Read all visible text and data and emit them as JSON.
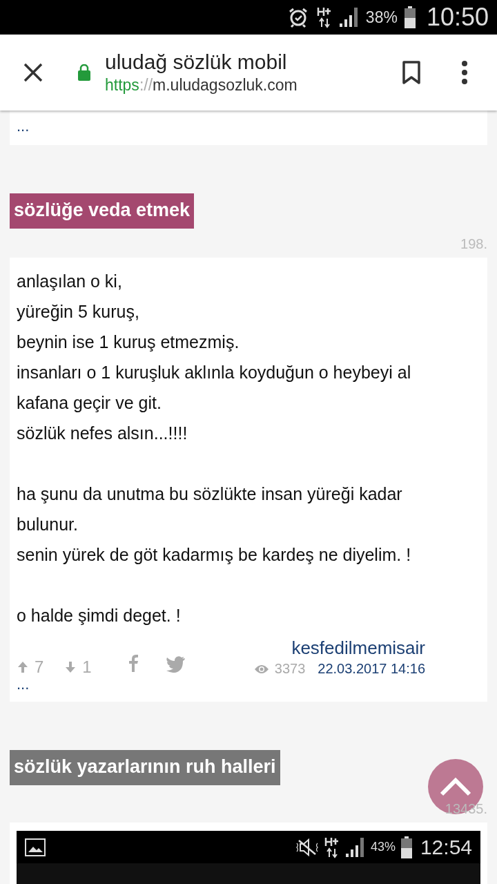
{
  "status_bar": {
    "battery": "38%",
    "time": "10:50"
  },
  "browser_bar": {
    "title": "uludağ sözlük mobil",
    "url_scheme": "https",
    "url_separator": "://",
    "url_host": "m.uludagsozluk.com"
  },
  "previous_entry": {
    "more": "..."
  },
  "topics": [
    {
      "title": "sözlüğe veda etmek",
      "color": "#a4486f",
      "entry_number": "198.",
      "entry": {
        "paragraphs": [
          [
            "anlaşılan o ki,",
            "yüreğin 5 kuruş,",
            "beynin ise 1 kuruş etmezmiş.",
            "insanları o 1 kuruşluk aklınla koyduğun o heybeyi al kafana geçir ve git.",
            "sözlük nefes alsın...!!!!"
          ],
          [
            "ha şunu da unutma bu sözlükte insan yüreği kadar bulunur.",
            "senin yürek de göt kadarmış be kardeş ne diyelim. !"
          ],
          [
            "o halde şimdi deget. !"
          ]
        ],
        "upvotes": "7",
        "downvotes": "1",
        "author": "kesfedilmemisair",
        "views": "3373",
        "date": "22.03.2017 14:16",
        "more": "..."
      }
    },
    {
      "title": "sözlük yazarlarının ruh halleri",
      "color": "#777777",
      "entry_number": "13435.",
      "entry": {
        "screenshot": {
          "battery": "43%",
          "time": "12:54"
        }
      }
    }
  ]
}
